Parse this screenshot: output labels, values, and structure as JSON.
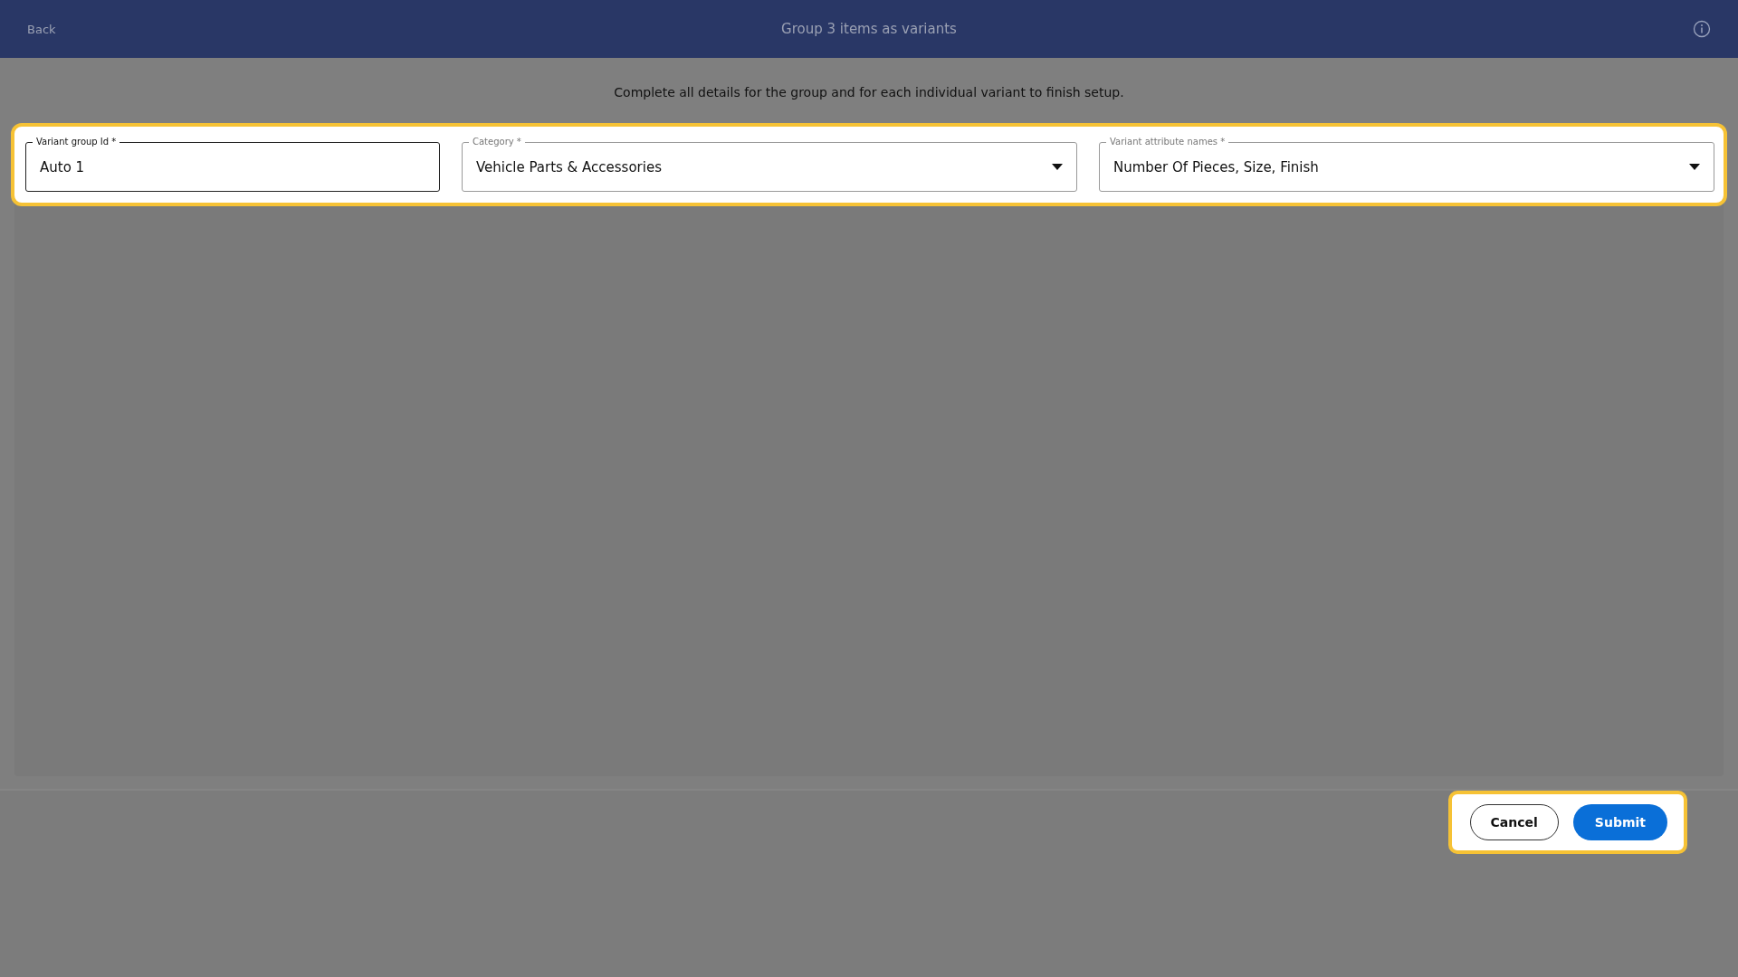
{
  "header": {
    "back": "Back",
    "title": "Group 3 items as variants"
  },
  "instructions": "Complete all details for the group and for each individual variant to finish setup.",
  "fields": [
    {
      "kind": "text",
      "label": "Variant group Id *",
      "value": "Auto 1",
      "focused": true
    },
    {
      "kind": "select",
      "label": "Category *",
      "value": "Vehicle Parts & Accessories",
      "focused": false
    },
    {
      "kind": "select",
      "label": "Variant attribute names *",
      "value": "Number Of Pieces, Size, Finish",
      "focused": false
    }
  ],
  "buttons": [
    {
      "kind": "secondary",
      "label": "Cancel"
    },
    {
      "kind": "primary",
      "label": "Submit"
    }
  ]
}
